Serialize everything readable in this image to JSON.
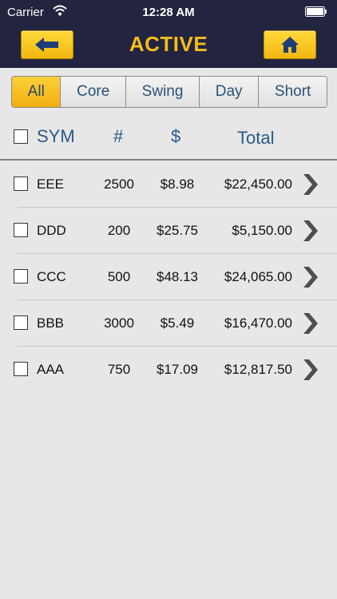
{
  "status_bar": {
    "carrier": "Carrier",
    "time": "12:28 AM"
  },
  "nav": {
    "title": "ACTIVE",
    "back_icon": "back-arrow-icon",
    "home_icon": "home-icon"
  },
  "tabs": [
    {
      "label": "All",
      "selected": true
    },
    {
      "label": "Core",
      "selected": false
    },
    {
      "label": "Swing",
      "selected": false
    },
    {
      "label": "Day",
      "selected": false
    },
    {
      "label": "Short",
      "selected": false
    }
  ],
  "table": {
    "headers": {
      "sym": "SYM",
      "qty": "#",
      "price": "$",
      "total": "Total"
    },
    "rows": [
      {
        "sym": "EEE",
        "qty": "2500",
        "price": "$8.98",
        "total": "$22,450.00"
      },
      {
        "sym": "DDD",
        "qty": "200",
        "price": "$25.75",
        "total": "$5,150.00"
      },
      {
        "sym": "CCC",
        "qty": "500",
        "price": "$48.13",
        "total": "$24,065.00"
      },
      {
        "sym": "BBB",
        "qty": "3000",
        "price": "$5.49",
        "total": "$16,470.00"
      },
      {
        "sym": "AAA",
        "qty": "750",
        "price": "$17.09",
        "total": "$12,817.50"
      }
    ]
  },
  "colors": {
    "nav_bg": "#232440",
    "accent": "#f5bd18",
    "header_text": "#2a5b88"
  }
}
